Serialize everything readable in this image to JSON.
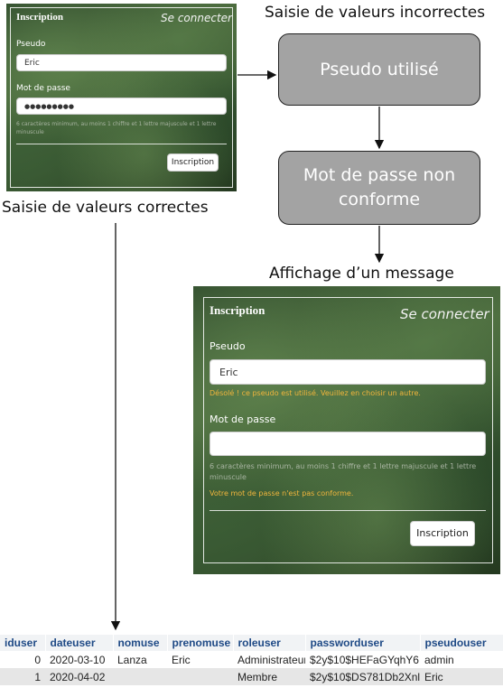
{
  "captions": {
    "incorrect": "Saisie de valeurs incorrectes",
    "correct": "Saisie de valeurs correctes",
    "message": "Affichage d’un message"
  },
  "flow": {
    "box1": "Pseudo utilisé",
    "box2_line1": "Mot de passe non",
    "box2_line2": "conforme"
  },
  "form_small": {
    "title": "Inscription",
    "switch_link": "Se connecter",
    "pseudo_label": "Pseudo",
    "pseudo_value": "Eric",
    "password_label": "Mot de passe",
    "password_value": "●●●●●●●●●",
    "hint": "6 caractères minimum, au moins 1 chiffre et 1 lettre majuscule et 1 lettre minuscule",
    "button": "Inscription"
  },
  "form_large": {
    "title": "Inscription",
    "switch_link": "Se connecter",
    "pseudo_label": "Pseudo",
    "pseudo_value": "Eric",
    "pseudo_error": "Désolé ! ce pseudo est utilisé. Veuillez en choisir un autre.",
    "password_label": "Mot de passe",
    "password_value": "",
    "hint": "6 caractères minimum, au moins 1 chiffre et 1 lettre majuscule et 1 lettre minuscule",
    "password_error": "Votre mot de passe n'est pas conforme.",
    "button": "Inscription"
  },
  "table": {
    "headers": [
      "iduser",
      "dateuser",
      "nomuse",
      "prenomuse",
      "roleuser",
      "passworduser",
      "pseudouser"
    ],
    "rows": [
      [
        "0",
        "2020-03-10",
        "Lanza",
        "Eric",
        "Administrateur",
        "$2y$10$HEFaGYqhY6",
        "admin"
      ],
      [
        "1",
        "2020-04-02",
        "",
        "",
        "Membre",
        "$2y$10$DS781Db2Xnl",
        "Eric"
      ]
    ]
  }
}
